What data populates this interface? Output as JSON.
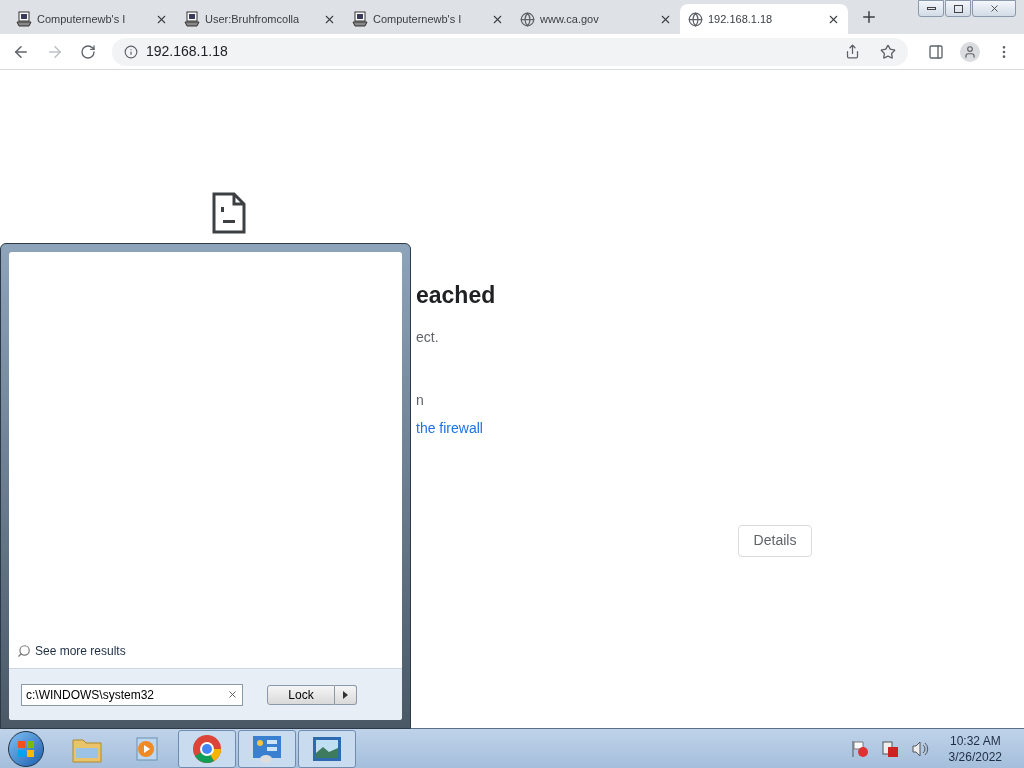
{
  "tabs": [
    {
      "title": "Computernewb's I",
      "selected": false,
      "kind": "wiki"
    },
    {
      "title": "User:Bruhfromcolla",
      "selected": false,
      "kind": "wiki"
    },
    {
      "title": "Computernewb's I",
      "selected": false,
      "kind": "wiki"
    },
    {
      "title": "www.ca.gov",
      "selected": false,
      "kind": "globe"
    },
    {
      "title": "192.168.1.18",
      "selected": true,
      "kind": "globe"
    }
  ],
  "address_bar": {
    "value": "192.168.1.18"
  },
  "error_page": {
    "heading": "eached",
    "lines": [
      {
        "text": "ect.",
        "kind": "plain"
      },
      {
        "text": "n",
        "kind": "plain"
      },
      {
        "text": "the firewall",
        "kind": "link"
      }
    ],
    "details_button": "Details"
  },
  "start_menu": {
    "see_more": "See more results",
    "search": {
      "value": "c:\\WINDOWS\\system32"
    },
    "power_button": "Lock"
  },
  "taskbar": {
    "pinned": [
      {
        "kind": "explorer",
        "active": false
      },
      {
        "kind": "media",
        "active": false
      },
      {
        "kind": "chrome",
        "active": true
      },
      {
        "kind": "control",
        "active": true
      },
      {
        "kind": "photo",
        "active": true
      }
    ],
    "clock": {
      "time": "10:32 AM",
      "date": "3/26/2022"
    }
  }
}
